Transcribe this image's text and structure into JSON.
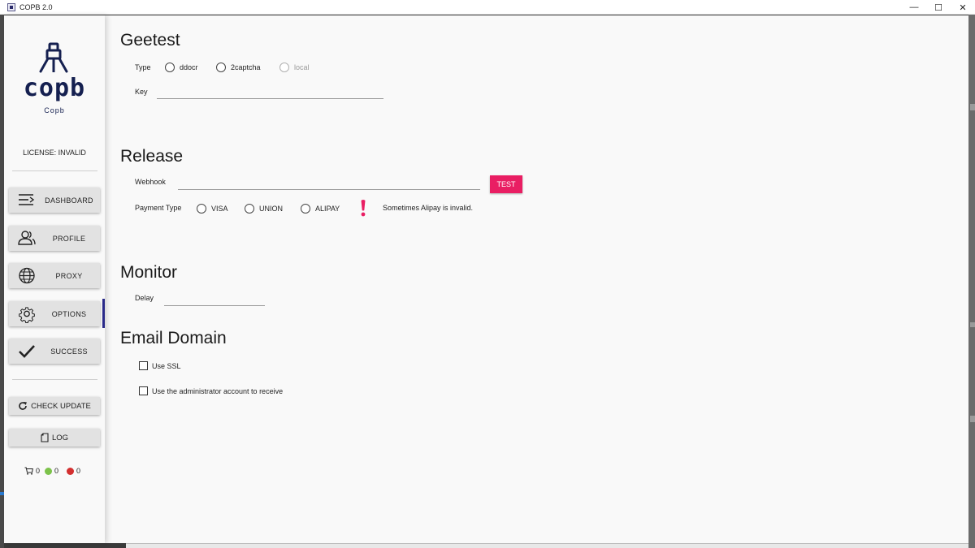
{
  "window": {
    "title": "COPB 2.0",
    "controls": {
      "minimize": "—",
      "maximize": "☐",
      "close": "✕"
    }
  },
  "sidebar": {
    "logo_text": "copb",
    "logo_sub": "Copb",
    "license": "LICENSE: INVALID",
    "nav": [
      {
        "label": "DASHBOARD",
        "icon": "menu-lines-icon"
      },
      {
        "label": "PROFILE",
        "icon": "people-icon"
      },
      {
        "label": "PROXY",
        "icon": "globe-icon"
      },
      {
        "label": "OPTIONS",
        "icon": "gear-icon",
        "active": true
      },
      {
        "label": "SUCCESS",
        "icon": "checkmark-icon"
      }
    ],
    "check_update_label": "CHECK UPDATE",
    "log_label": "LOG",
    "stats": {
      "cart": "0",
      "green": "0",
      "red": "0"
    }
  },
  "main": {
    "geetest": {
      "title": "Geetest",
      "type_label": "Type",
      "options": [
        "ddocr",
        "2captcha",
        "local"
      ],
      "key_label": "Key",
      "key_value": ""
    },
    "release": {
      "title": "Release",
      "webhook_label": "Webhook",
      "webhook_value": "",
      "test_label": "TEST",
      "payment_label": "Payment Type",
      "payment_options": [
        "VISA",
        "UNION",
        "ALIPAY"
      ],
      "note": "Sometimes Alipay is invalid."
    },
    "monitor": {
      "title": "Monitor",
      "delay_label": "Delay",
      "delay_value": ""
    },
    "email": {
      "title": "Email Domain",
      "use_ssl_label": "Use SSL",
      "use_admin_label": "Use the administrator account to receive"
    }
  },
  "colors": {
    "accent": "#e91e63",
    "brand": "#152050",
    "active_indicator": "#2a2a8a",
    "status_green": "#7cc24a",
    "status_red": "#d32f2f"
  }
}
